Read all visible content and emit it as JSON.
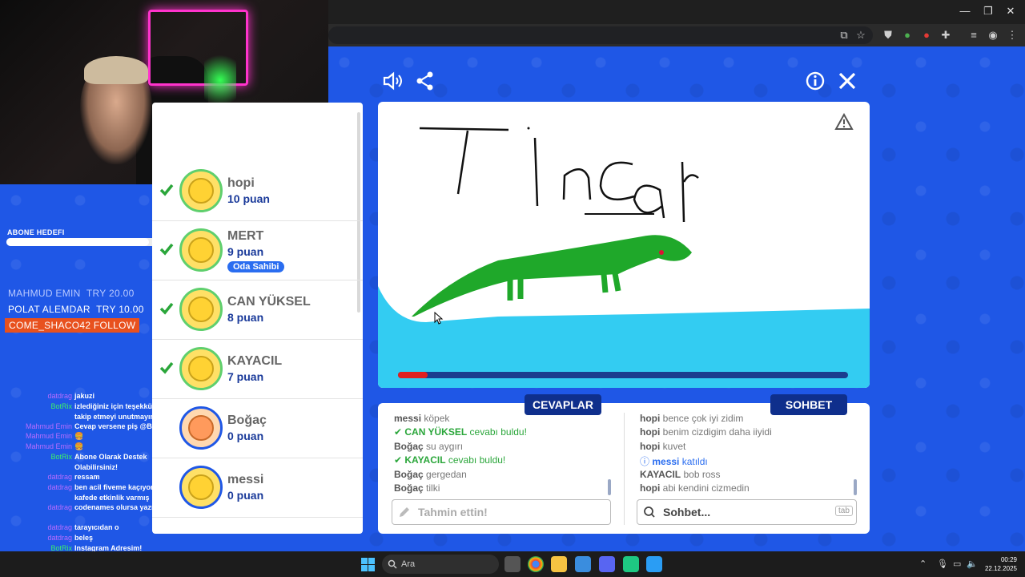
{
  "overlay": {
    "goal_label": "ABONE HEDEFI",
    "donors": [
      {
        "name": "MAHMUD EMIN",
        "amount": "TRY 20.00"
      },
      {
        "name": "POLAT ALEMDAR",
        "amount": "TRY 10.00"
      }
    ],
    "follow": "COME_SHACO42  FOLLOW",
    "chat": [
      {
        "user": "datdrag",
        "text": "jakuzi"
      },
      {
        "user": "BotRix",
        "text": "izlediğiniz için teşekkürler... takip etmeyi unutmayın"
      },
      {
        "user": "Mahmud Emin",
        "text": "Cevap versene piş @BotRix"
      },
      {
        "user": "Mahmud Emin",
        "text": "🍔"
      },
      {
        "user": "Mahmud Emin",
        "text": "🍔"
      },
      {
        "user": "BotRix",
        "text": "Abone Olarak Destek Olabilirsiniz!"
      },
      {
        "user": "datdrag",
        "text": "ressam"
      },
      {
        "user": "datdrag",
        "text": "ben acil fiveme kaçıyorum kafede etkinlik varmış"
      },
      {
        "user": "datdrag",
        "text": "codenames olursa yazın dcden"
      },
      {
        "user": "datdrag",
        "text": "tarayıcıdan o"
      },
      {
        "user": "datdrag",
        "text": "beleş"
      },
      {
        "user": "BotRix",
        "text": "Instagram Adresim! https://www.instagram.com/mertfatihyigit/"
      }
    ]
  },
  "players": [
    {
      "name": "hopi",
      "points": "10 puan",
      "guessed": true
    },
    {
      "name": "MERT",
      "points": "9 puan",
      "guessed": true,
      "badge": "Oda Sahibi"
    },
    {
      "name": "CAN YÜKSEL",
      "points": "8 puan",
      "guessed": true
    },
    {
      "name": "KAYACIL",
      "points": "7 puan",
      "guessed": true
    },
    {
      "name": "Boğaç",
      "points": "0 puan",
      "guessed": false
    },
    {
      "name": "messi",
      "points": "0 puan",
      "guessed": false
    }
  ],
  "canvas": {
    "drawn_word": "Tincar",
    "timer_fraction": 0.065
  },
  "answers": {
    "tab_label": "CEVAPLAR",
    "placeholder": "Tahmin ettin!",
    "lines": [
      {
        "user": "messi",
        "text": "köpek",
        "type": "guess"
      },
      {
        "user": "CAN YÜKSEL",
        "text": "cevabı buldu!",
        "type": "found"
      },
      {
        "user": "Boğaç",
        "text": "su aygırı",
        "type": "guess"
      },
      {
        "user": "KAYACIL",
        "text": "cevabı buldu!",
        "type": "found"
      },
      {
        "user": "Boğaç",
        "text": "gergedan",
        "type": "guess"
      },
      {
        "user": "Boğaç",
        "text": "tilki",
        "type": "guess"
      }
    ]
  },
  "chat": {
    "tab_label": "SOHBET",
    "placeholder": "Sohbet...",
    "tab_hint": "tab",
    "lines": [
      {
        "user": "hopi",
        "text": "bence çok iyi zidim",
        "type": "msg"
      },
      {
        "user": "hopi",
        "text": "benim cizdigim daha iiyidi",
        "type": "msg"
      },
      {
        "user": "hopi",
        "text": "kuvet",
        "type": "msg"
      },
      {
        "user": "messi",
        "text": "katıldı",
        "type": "join"
      },
      {
        "user": "KAYACIL",
        "text": "bob ross",
        "type": "msg"
      },
      {
        "user": "hopi",
        "text": "abi kendini cizmedin",
        "type": "msg"
      }
    ]
  },
  "taskbar": {
    "search": "Ara",
    "time": "00:29",
    "date": "22.12.2025"
  },
  "colors": {
    "accent": "#1f57e6",
    "tab": "#0f2f8c",
    "found": "#2aa63a"
  }
}
